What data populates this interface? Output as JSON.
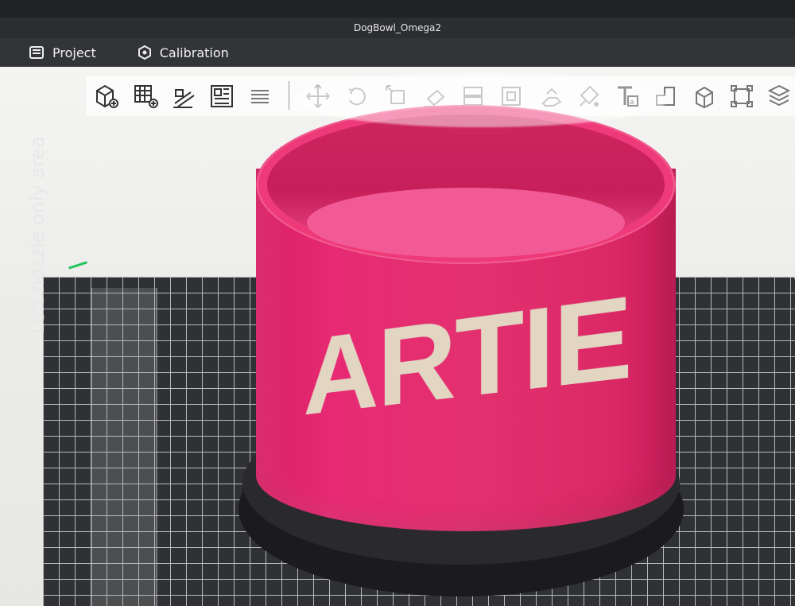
{
  "window": {
    "title": "DogBowl_Omega2"
  },
  "menu": {
    "project": "Project",
    "calibration": "Calibration"
  },
  "toolbar": {
    "icons": [
      "add-cube-icon",
      "add-grid-icon",
      "auto-arrange-icon",
      "layout-icon",
      "layers-icon",
      "move-icon",
      "rotate-icon",
      "scale-icon",
      "lay-flat-icon",
      "split-icon",
      "cut-icon",
      "support-paint-icon",
      "color-paint-icon",
      "text-icon",
      "measure-icon",
      "box-icon",
      "frame-icon",
      "slice-icon"
    ]
  },
  "scene": {
    "bowl_text": "ARTIE",
    "zone_label": "Left nozzle only area"
  },
  "colors": {
    "bowl": "#e3306f",
    "text": "#e2d5c2",
    "base": "#1b1b1d",
    "plate": "#303134"
  }
}
